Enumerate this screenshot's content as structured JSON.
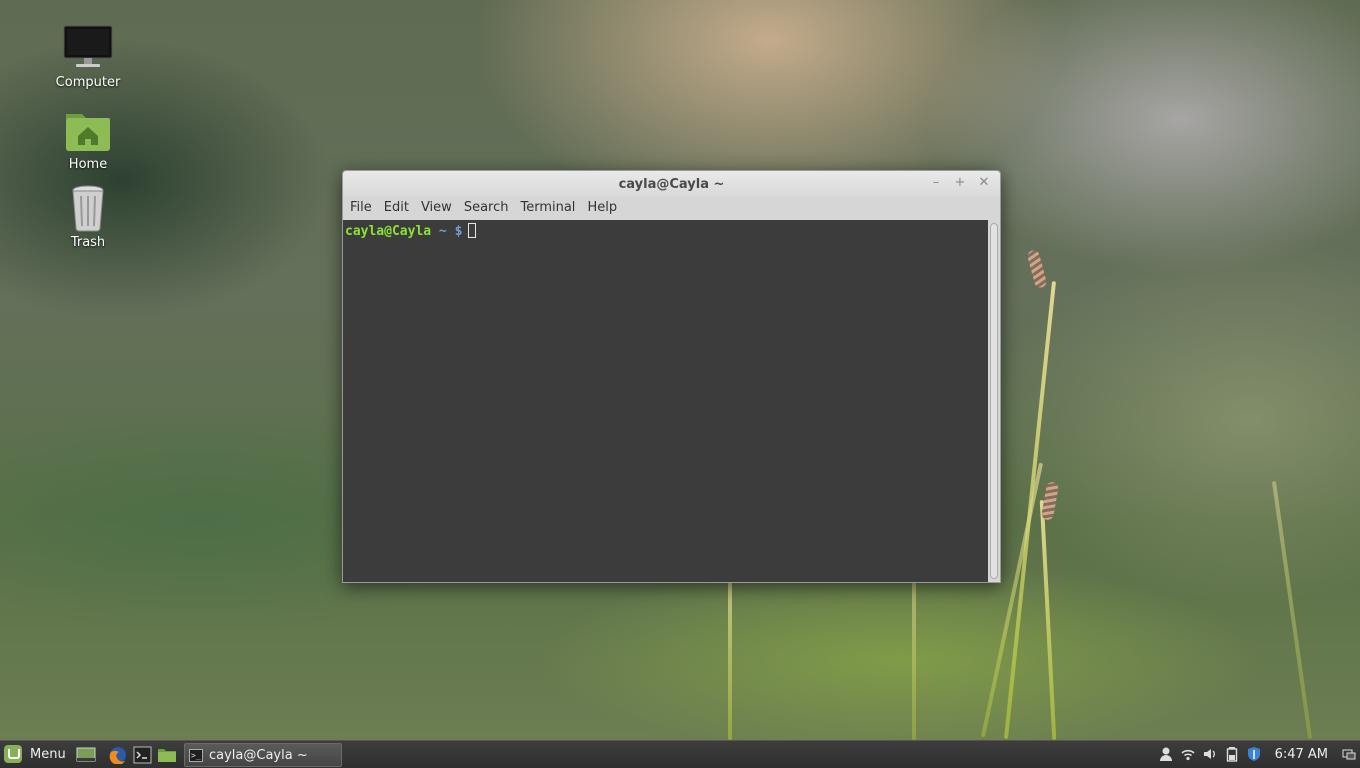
{
  "desktop": {
    "icons": [
      {
        "label": "Computer"
      },
      {
        "label": "Home"
      },
      {
        "label": "Trash"
      }
    ]
  },
  "terminal_window": {
    "title": "cayla@Cayla ~",
    "controls": {
      "minimize": "–",
      "maximize": "+",
      "close": "✕"
    },
    "menus": [
      "File",
      "Edit",
      "View",
      "Search",
      "Terminal",
      "Help"
    ],
    "prompt": {
      "user_host": "cayla@Cayla",
      "directory": "~",
      "symbol": "$"
    }
  },
  "panel": {
    "menu_label": "Menu",
    "launchers": [
      "show-desktop-icon",
      "firefox-icon",
      "terminal-icon",
      "files-icon"
    ],
    "task": {
      "label": "cayla@Cayla ~",
      "icon_glyph": ">_"
    },
    "tray": [
      "user-icon",
      "wifi-icon",
      "volume-icon",
      "battery-icon",
      "shield-icon"
    ],
    "clock": "6:47 AM"
  },
  "colors": {
    "terminal_bg": "#3c3c3c",
    "prompt_user": "#8ae234",
    "prompt_path": "#729fcf",
    "mint_green": "#87b158"
  }
}
